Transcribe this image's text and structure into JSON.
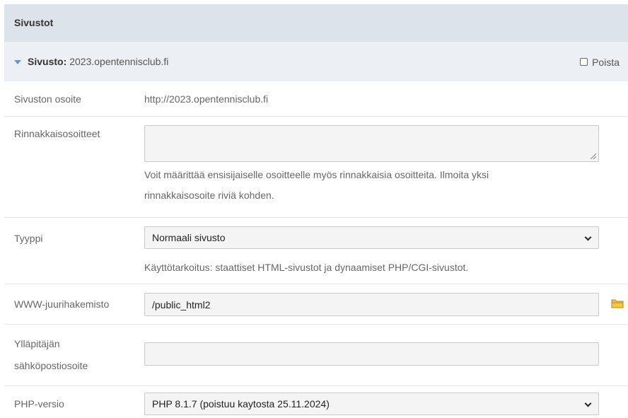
{
  "section": {
    "title": "Sivustot"
  },
  "site": {
    "label": "Sivusto:",
    "name": "2023.opentennisclub.fi",
    "delete_label": "Poista"
  },
  "fields": {
    "address": {
      "label": "Sivuston osoite",
      "value": "http://2023.opentennisclub.fi"
    },
    "aliases": {
      "label": "Rinnakkaisosoitteet",
      "value": "",
      "help_line1": "Voit määrittää ensisijaiselle osoitteelle myös rinnakkaisia osoitteita. Ilmoita yksi",
      "help_line2": "rinnakkaisosoite riviä kohden."
    },
    "type": {
      "label": "Tyyppi",
      "selected": "Normaali sivusto",
      "help": "Käyttötarkoitus: staattiset HTML-sivustot ja dynaamiset PHP/CGI-sivustot."
    },
    "docroot": {
      "label": "WWW-juurihakemisto",
      "value": "/public_html2"
    },
    "admin_email": {
      "label_line1": "Ylläpitäjän",
      "label_line2": "sähköpostiosoite",
      "value": ""
    },
    "php_version": {
      "label": "PHP-versio",
      "selected": "PHP 8.1.7 (poistuu kaytosta 25.11.2024)"
    }
  },
  "icons": {
    "expand": "triangle-down-icon",
    "folder": "folder-icon",
    "dropdown": "chevron-down-icon"
  },
  "colors": {
    "header_bg": "#dde3ea",
    "site_bar_bg": "#eceff3",
    "accent": "#5b9bd5",
    "folder": "#e8b830"
  }
}
